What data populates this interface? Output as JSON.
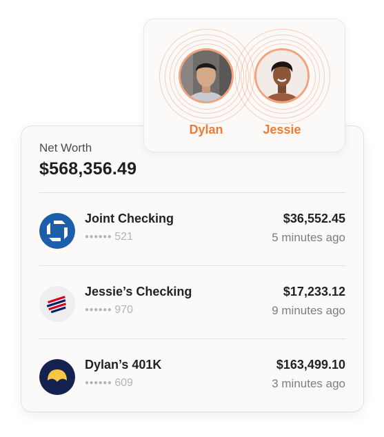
{
  "net_worth": {
    "label": "Net Worth",
    "value": "$568,356.49"
  },
  "accounts": [
    {
      "name": "Joint Checking",
      "mask": "521",
      "amount": "$36,552.45",
      "updated": "5 minutes ago",
      "logo": "chase-logo"
    },
    {
      "name": "Jessie’s Checking",
      "mask": "970",
      "amount": "$17,233.12",
      "updated": "9 minutes ago",
      "logo": "bank-of-america-logo"
    },
    {
      "name": "Dylan’s 401K",
      "mask": "609",
      "amount": "$163,499.10",
      "updated": "3 minutes ago",
      "logo": "401k-provider-logo"
    }
  ],
  "people": [
    {
      "name": "Dylan"
    },
    {
      "name": "Jessie"
    }
  ],
  "mask_dots": "●●●●●●",
  "colors": {
    "accent": "#f07a35",
    "chase_blue": "#1b5fab",
    "boa_red": "#d4001a",
    "boa_blue": "#012169",
    "navy": "#14224f",
    "gold": "#f6c644"
  }
}
